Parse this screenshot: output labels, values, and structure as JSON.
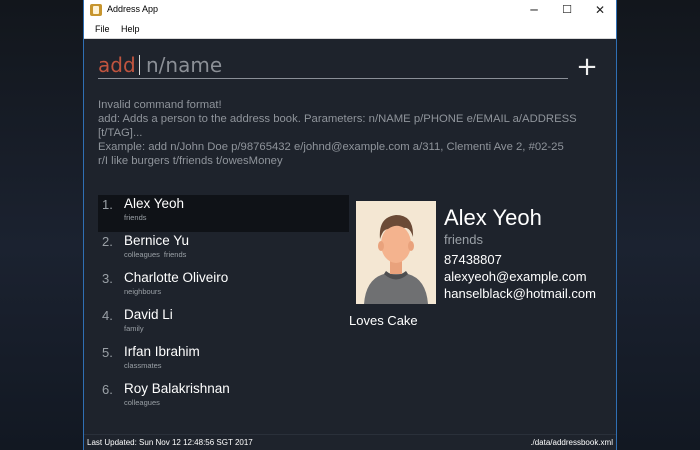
{
  "window": {
    "title": "Address App",
    "minimize": "─",
    "maximize": "☐",
    "close": "✕"
  },
  "menu": {
    "file": "File",
    "help": "Help"
  },
  "command": {
    "typed": "add",
    "placeholder": "n/name",
    "add_button": "+"
  },
  "result": {
    "lines": [
      "Invalid command format!",
      "add: Adds a person to the address book. Parameters: n/NAME p/PHONE e/EMAIL a/ADDRESS",
      "[t/TAG]...",
      "Example: add n/John Doe p/98765432 e/johnd@example.com a/311, Clementi Ave 2, #02-25",
      "r/I like burgers t/friends t/owesMoney"
    ]
  },
  "persons": [
    {
      "index": "1.",
      "name": "Alex Yeoh",
      "tags": [
        "friends"
      ]
    },
    {
      "index": "2.",
      "name": "Bernice Yu",
      "tags": [
        "colleagues",
        "friends"
      ]
    },
    {
      "index": "3.",
      "name": "Charlotte Oliveiro",
      "tags": [
        "neighbours"
      ]
    },
    {
      "index": "4.",
      "name": "David Li",
      "tags": [
        "family"
      ]
    },
    {
      "index": "5.",
      "name": "Irfan Ibrahim",
      "tags": [
        "classmates"
      ]
    },
    {
      "index": "6.",
      "name": "Roy Balakrishnan",
      "tags": [
        "colleagues"
      ]
    }
  ],
  "selected_index": 0,
  "detail": {
    "name": "Alex Yeoh",
    "tag": "friends",
    "phone": "87438807",
    "email": "alexyeoh@example.com",
    "email2": "hanselblack@hotmail.com",
    "remark": "Loves Cake",
    "avatar_icon": "person-avatar-icon"
  },
  "status": {
    "last_updated": "Last Updated: Sun Nov 12 12:48:56 SGT 2017",
    "file_path": "./data/addressbook.xml"
  },
  "colors": {
    "background": "#1e232c",
    "typed_command": "#c0543f",
    "selected_row": "#0f1217"
  }
}
